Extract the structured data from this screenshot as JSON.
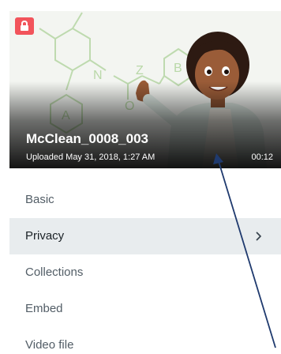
{
  "video": {
    "title": "McClean_0008_003",
    "uploaded": "Uploaded May 31, 2018, 1:27 AM",
    "duration": "00:12",
    "thumbnail_icon": "scientist-molecule-illustration",
    "lock_icon": "lock-icon",
    "lock_color": "#f2545b"
  },
  "menu": {
    "items": [
      {
        "label": "Basic"
      },
      {
        "label": "Privacy"
      },
      {
        "label": "Collections"
      },
      {
        "label": "Embed"
      },
      {
        "label": "Video file"
      }
    ],
    "active_index": 1,
    "chevron_icon": "chevron-right-icon",
    "active_background": "#e8ecee"
  },
  "annotation": {
    "arrow_color": "#1f3a6e"
  }
}
